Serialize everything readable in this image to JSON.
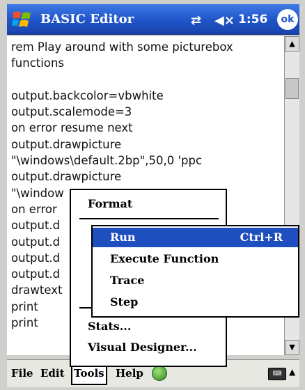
{
  "titlebar": {
    "app_title": "BASIC Editor",
    "clock": "1:56",
    "ok_label": "ok",
    "icons": [
      "windows-start-icon",
      "connectivity-icon",
      "volume-muted-icon"
    ]
  },
  "editor": {
    "lines": [
      "rem Play around with some picturebox",
      "functions",
      "",
      "output.backcolor=vbwhite",
      "output.scalemode=3",
      "on error resume next",
      "output.drawpicture",
      "\"\\windows\\default.2bp\",50,0 'ppc",
      "output.drawpicture",
      "\"\\window                         pc pro",
      "on error",
      "output.d",
      "output.d",
      "output.d",
      "output.d",
      "drawtext",
      "print",
      "print"
    ]
  },
  "menubar": {
    "items": [
      "File",
      "Edit",
      "Tools",
      "Help"
    ],
    "active": "Tools"
  },
  "tools_menu": {
    "items": [
      "Format",
      "Stats...",
      "Visual Designer..."
    ]
  },
  "run_menu": {
    "items": [
      {
        "label": "Run",
        "shortcut": "Ctrl+R",
        "selected": true
      },
      {
        "label": "Execute Function",
        "shortcut": "",
        "selected": false
      },
      {
        "label": "Trace",
        "shortcut": "",
        "selected": false
      },
      {
        "label": "Step",
        "shortcut": "",
        "selected": false
      }
    ]
  },
  "colors": {
    "titlebar": "#1f54c8",
    "selection": "#1f4fbf"
  }
}
